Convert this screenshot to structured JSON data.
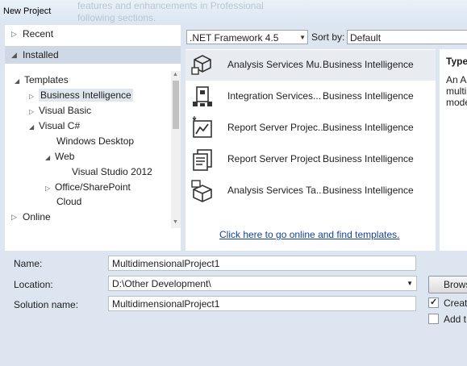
{
  "window": {
    "title": "New Project",
    "ghost_line1": "features and enhancements in Professional",
    "ghost_line2": "following sections."
  },
  "sidebar": {
    "recent": "Recent",
    "installed": "Installed",
    "online": "Online",
    "tree": [
      {
        "label": "Templates"
      },
      {
        "label": "Business Intelligence"
      },
      {
        "label": "Visual Basic"
      },
      {
        "label": "Visual C#"
      },
      {
        "label": "Windows Desktop"
      },
      {
        "label": "Web"
      },
      {
        "label": "Visual Studio 2012"
      },
      {
        "label": "Office/SharePoint"
      },
      {
        "label": "Cloud"
      }
    ]
  },
  "toolbar": {
    "framework": ".NET Framework 4.5",
    "sort_label": "Sort by:",
    "sort_value": "Default"
  },
  "templates": [
    {
      "name": "Analysis Services Mu...",
      "category": "Business Intelligence",
      "icon": "analysis-multidimensional-icon"
    },
    {
      "name": "Integration Services...",
      "category": "Business Intelligence",
      "icon": "integration-services-icon"
    },
    {
      "name": "Report Server Projec...",
      "category": "Business Intelligence",
      "icon": "report-wizard-icon"
    },
    {
      "name": "Report Server Project",
      "category": "Business Intelligence",
      "icon": "report-server-icon"
    },
    {
      "name": "Analysis Services Ta...",
      "category": "Business Intelligence",
      "icon": "analysis-tabular-icon"
    }
  ],
  "online_link": "Click here to go online and find templates.",
  "details": {
    "type_label": "Type",
    "description": "An A\nmulti\nmode"
  },
  "form": {
    "name_label": "Name:",
    "name_value": "MultidimensionalProject1",
    "location_label": "Location:",
    "location_value": "D:\\Other Development\\",
    "solution_label": "Solution name:",
    "solution_value": "MultidimensionalProject1",
    "browse_label": "Brows",
    "create_dir_label": "Creat",
    "create_dir_checked": true,
    "add_label": "Add t",
    "add_checked": false
  },
  "colors": {
    "selection": "#dfe6ee",
    "link": "#0f3fb5",
    "chrome": "#dde6f0"
  }
}
